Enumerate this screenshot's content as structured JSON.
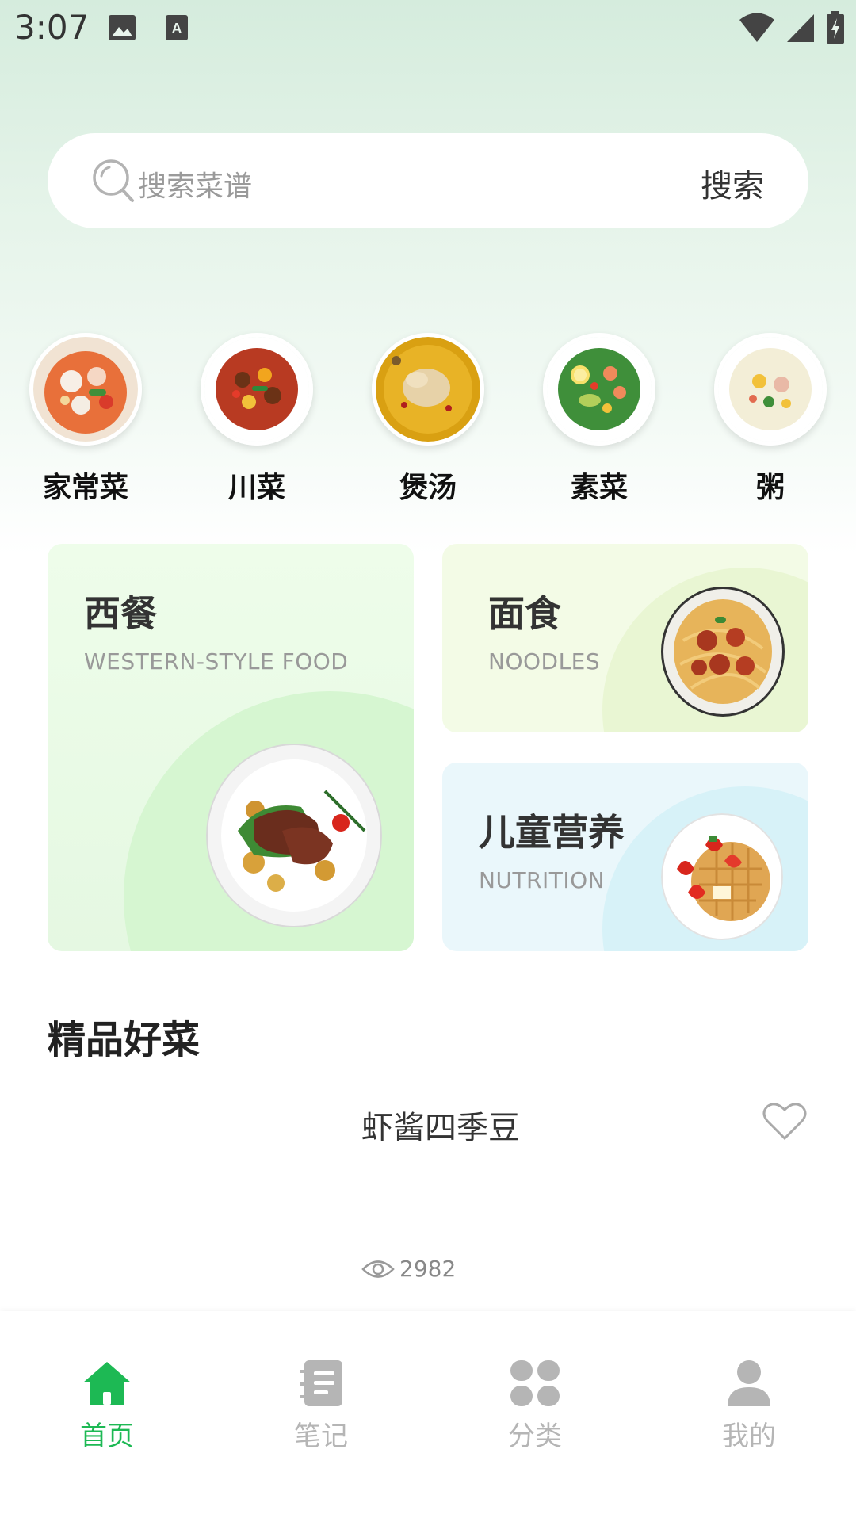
{
  "status_bar": {
    "time": "3:07",
    "icons": [
      "image-icon",
      "text-badge-icon",
      "wifi-icon",
      "cell-signal-icon",
      "battery-icon"
    ]
  },
  "search": {
    "placeholder": "搜索菜谱",
    "button_label": "搜索"
  },
  "categories": [
    {
      "label": "家常菜",
      "image": "seafood-soup-bowl"
    },
    {
      "label": "川菜",
      "image": "sichuan-stir-fry-bowl"
    },
    {
      "label": "煲汤",
      "image": "chicken-soup-bowl"
    },
    {
      "label": "素菜",
      "image": "salad-bowl"
    },
    {
      "label": "粥",
      "image": "porridge-bowl"
    }
  ],
  "features": {
    "western": {
      "title": "西餐",
      "subtitle": "WESTERN-STYLE FOOD",
      "image": "steak-plate"
    },
    "noodles": {
      "title": "面食",
      "subtitle": "NOODLES",
      "image": "spaghetti-meatball-plate"
    },
    "kids": {
      "title": "儿童营养",
      "subtitle": "NUTRITION",
      "image": "strawberry-waffle-plate"
    }
  },
  "section": {
    "title": "精品好菜",
    "recipe": {
      "name": "虾酱四季豆",
      "views": "2982"
    }
  },
  "bottom_nav": [
    {
      "label": "首页",
      "icon": "home-icon",
      "active": true
    },
    {
      "label": "笔记",
      "icon": "notes-icon",
      "active": false
    },
    {
      "label": "分类",
      "icon": "category-grid-icon",
      "active": false
    },
    {
      "label": "我的",
      "icon": "profile-icon",
      "active": false
    }
  ],
  "colors": {
    "accent": "#1db954",
    "inactive": "#b5b5b5",
    "western_card_bg": "#e9f9e9",
    "noodles_card_bg": "#f3fbe6",
    "kids_card_bg": "#eaf7fb"
  }
}
